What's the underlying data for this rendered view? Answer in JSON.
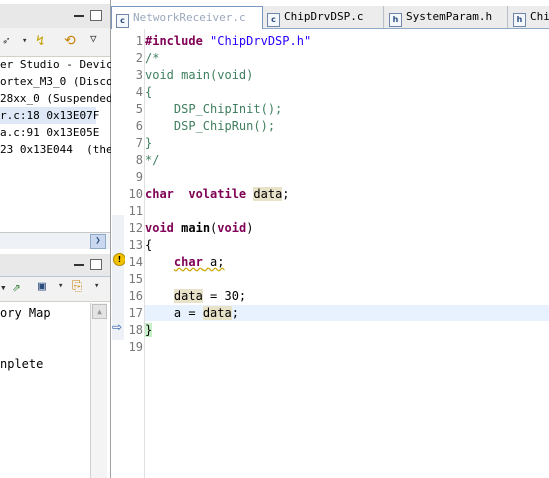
{
  "debug_view": {
    "tree": [
      "er Studio - Device",
      "ortex_M3_0 (Disco",
      "28xx_0 (Suspended)",
      "r.c:18 0x13E07F",
      "a.c:91 0x13E05E",
      "23 0x13E044  (the"
    ]
  },
  "bottom_view": {
    "lines": [
      "ory Map",
      "",
      "",
      "nplete"
    ]
  },
  "editor": {
    "tabs": [
      {
        "label": "NetworkReceiver.c",
        "icon": "c"
      },
      {
        "label": "ChipDrvDSP.c",
        "icon": "c"
      },
      {
        "label": "SystemParam.h",
        "icon": "h"
      },
      {
        "label": "Chi",
        "icon": "h"
      }
    ],
    "line_numbers": [
      "1",
      "2",
      "3",
      "4",
      "5",
      "6",
      "7",
      "8",
      "9",
      "10",
      "11",
      "12",
      "13",
      "14",
      "15",
      "16",
      "17",
      "18",
      "19"
    ],
    "code": {
      "l1_kw": "#include",
      "l1_str": "\"ChipDrvDSP.h\"",
      "l2": "/*",
      "l3": "void main(void)",
      "l4": "{",
      "l5": "    DSP_ChipInit();",
      "l6": "    DSP_ChipRun();",
      "l7": "}",
      "l8": "*/",
      "l10_kw1": "char",
      "l10_kw2": "volatile",
      "l10_var": "data",
      "l10_end": ";",
      "l12_kw": "void",
      "l12_fn": "main",
      "l12_p1": "(",
      "l12_kw2": "void",
      "l12_p2": ")",
      "l13": "{",
      "l14_kw": "char",
      "l14_rest": " a;",
      "l16_var": "data",
      "l16_rest": " = 30;",
      "l17_a": "a = ",
      "l17_var": "data",
      "l17_end": ";",
      "l18": "}"
    }
  }
}
